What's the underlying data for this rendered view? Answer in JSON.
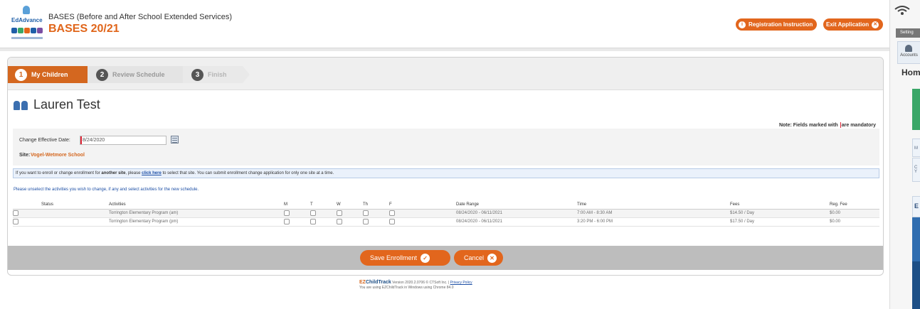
{
  "header": {
    "app_subtitle": "BASES (Before and After School Extended Services)",
    "app_title": "BASES 20/21",
    "logo_text": "EdAdvance",
    "registration_label": "Registration Instruction",
    "exit_label": "Exit Application"
  },
  "right_panel": {
    "setting_label": "Setting",
    "account_label": "Accounts",
    "home_label": "Hom",
    "box1_label": "M",
    "box2_label": "C Y",
    "e_label": "E"
  },
  "wizard": {
    "steps": [
      {
        "num": "1",
        "label": "My Children"
      },
      {
        "num": "2",
        "label": "Review Schedule"
      },
      {
        "num": "3",
        "label": "Finish"
      }
    ]
  },
  "child": {
    "name": "Lauren Test"
  },
  "note": {
    "prefix": "Note: Fields marked with",
    "suffix": "are mandatory"
  },
  "form": {
    "effective_date_label": "Change Effective Date:",
    "effective_date_value": "8/24/2020",
    "site_label": "Site:",
    "site_value": "Vogel-Wetmore School"
  },
  "info": {
    "t1": "If you want to enroll or change enrollment for",
    "t2": "another site",
    "t3": ", please",
    "link": "click here",
    "t4": "to select that site. You can submit enrollment change application for only one site at a time."
  },
  "instruction": "Please unselect the activities you wish to change, if any and select activities for the new schedule.",
  "table": {
    "headers": {
      "status": "Status",
      "activities": "Activities",
      "m": "M",
      "t": "T",
      "w": "W",
      "th": "Th",
      "f": "F",
      "date_range": "Date Range",
      "time": "Time",
      "fees": "Fees",
      "reg_fee": "Reg. Fee"
    },
    "rows": [
      {
        "status": "",
        "activity": "Torrington Elementary Program (am)",
        "date_range": "08/24/2020 - 06/11/2021",
        "time": "7:00 AM - 8:30 AM",
        "fees": "$14.50 / Day",
        "reg_fee": "$0.00"
      },
      {
        "status": "",
        "activity": "Torrington Elementary Program (pm)",
        "date_range": "08/24/2020 - 06/11/2021",
        "time": "3:20 PM - 6:00 PM",
        "fees": "$17.50 / Day",
        "reg_fee": "$0.00"
      }
    ]
  },
  "actions": {
    "save_label": "Save Enrollment",
    "cancel_label": "Cancel"
  },
  "footer": {
    "brand_ez": "EZ",
    "brand_rest": "ChildTrack",
    "version_text": "Version 2020.2.0706 © CTSoft Inc. |",
    "privacy": "Privacy Policy",
    "browser_text": "You are using EZChildTrack in Windows using Chrome 84.0"
  },
  "colors": {
    "accent": "#e2661d",
    "link": "#1d4fa5",
    "panel_bg": "#f3f3f3"
  }
}
